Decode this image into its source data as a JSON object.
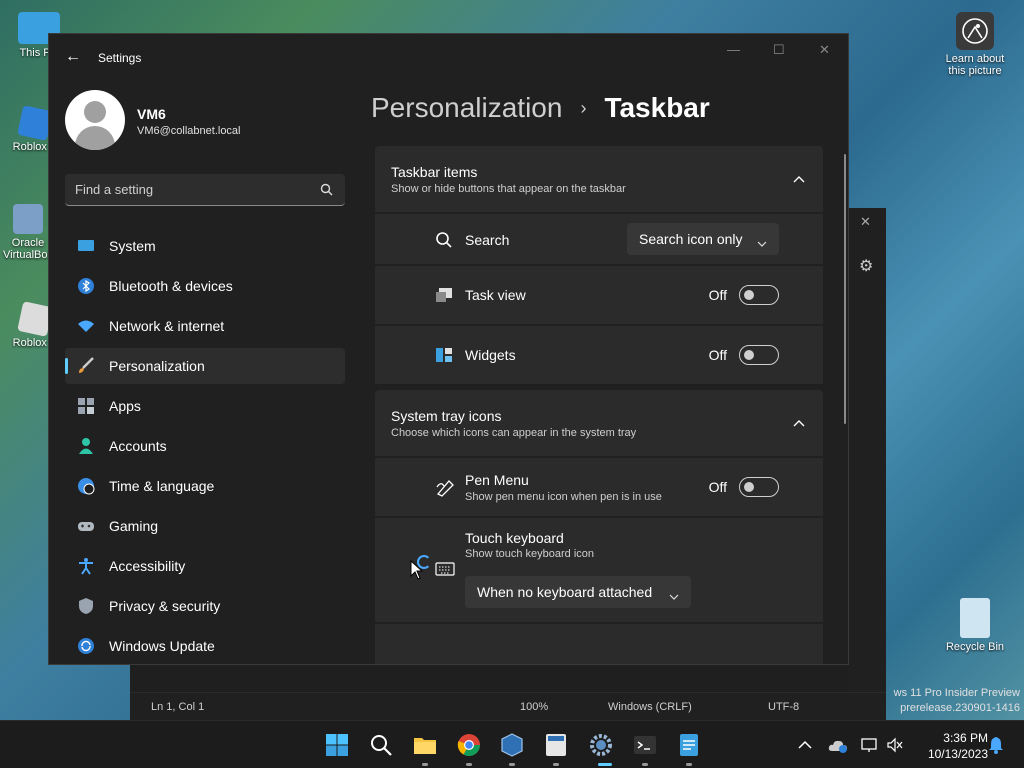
{
  "desktop": {
    "icons": [
      {
        "label": "This PC"
      },
      {
        "label": "Roblox S"
      },
      {
        "label": "Oracle VirtualBox"
      },
      {
        "label": "Roblox P"
      }
    ],
    "learn_label": "Learn about this picture",
    "recycle_label": "Recycle Bin",
    "watermark_line1": "ws 11 Pro Insider Preview",
    "watermark_line2": "prerelease.230901-1416"
  },
  "notepad": {
    "position": "Ln 1, Col 1",
    "zoom": "100%",
    "line_ending": "Windows (CRLF)",
    "encoding": "UTF-8"
  },
  "window": {
    "title": "Settings",
    "minimize": "—",
    "maximize": "☐",
    "close": "✕"
  },
  "profile": {
    "name": "VM6",
    "email": "VM6@collabnet.local"
  },
  "search": {
    "placeholder": "Find a setting"
  },
  "nav": {
    "items": [
      {
        "label": "System",
        "icon": "system-icon"
      },
      {
        "label": "Bluetooth & devices",
        "icon": "bluetooth-icon"
      },
      {
        "label": "Network & internet",
        "icon": "wifi-icon"
      },
      {
        "label": "Personalization",
        "icon": "brush-icon"
      },
      {
        "label": "Apps",
        "icon": "apps-icon"
      },
      {
        "label": "Accounts",
        "icon": "accounts-icon"
      },
      {
        "label": "Time & language",
        "icon": "globe-clock-icon"
      },
      {
        "label": "Gaming",
        "icon": "gamepad-icon"
      },
      {
        "label": "Accessibility",
        "icon": "accessibility-icon"
      },
      {
        "label": "Privacy & security",
        "icon": "shield-icon"
      },
      {
        "label": "Windows Update",
        "icon": "update-icon"
      }
    ],
    "active_index": 3
  },
  "breadcrumb": {
    "parent": "Personalization",
    "separator": "›",
    "current": "Taskbar"
  },
  "taskbar_items": {
    "title": "Taskbar items",
    "subtitle": "Show or hide buttons that appear on the taskbar",
    "search_label": "Search",
    "search_value": "Search icon only",
    "task_view_label": "Task view",
    "task_view_state": "Off",
    "widgets_label": "Widgets",
    "widgets_state": "Off"
  },
  "tray_icons": {
    "title": "System tray icons",
    "subtitle": "Choose which icons can appear in the system tray",
    "pen_label": "Pen Menu",
    "pen_sub": "Show pen menu icon when pen is in use",
    "pen_state": "Off",
    "touch_label": "Touch keyboard",
    "touch_sub": "Show touch keyboard icon",
    "touch_value": "When no keyboard attached"
  },
  "clock": {
    "time": "3:36 PM",
    "date": "10/13/2023"
  },
  "colors": {
    "accent": "#60cdff",
    "window_bg": "#202020",
    "card_bg": "#2b2b2b"
  }
}
